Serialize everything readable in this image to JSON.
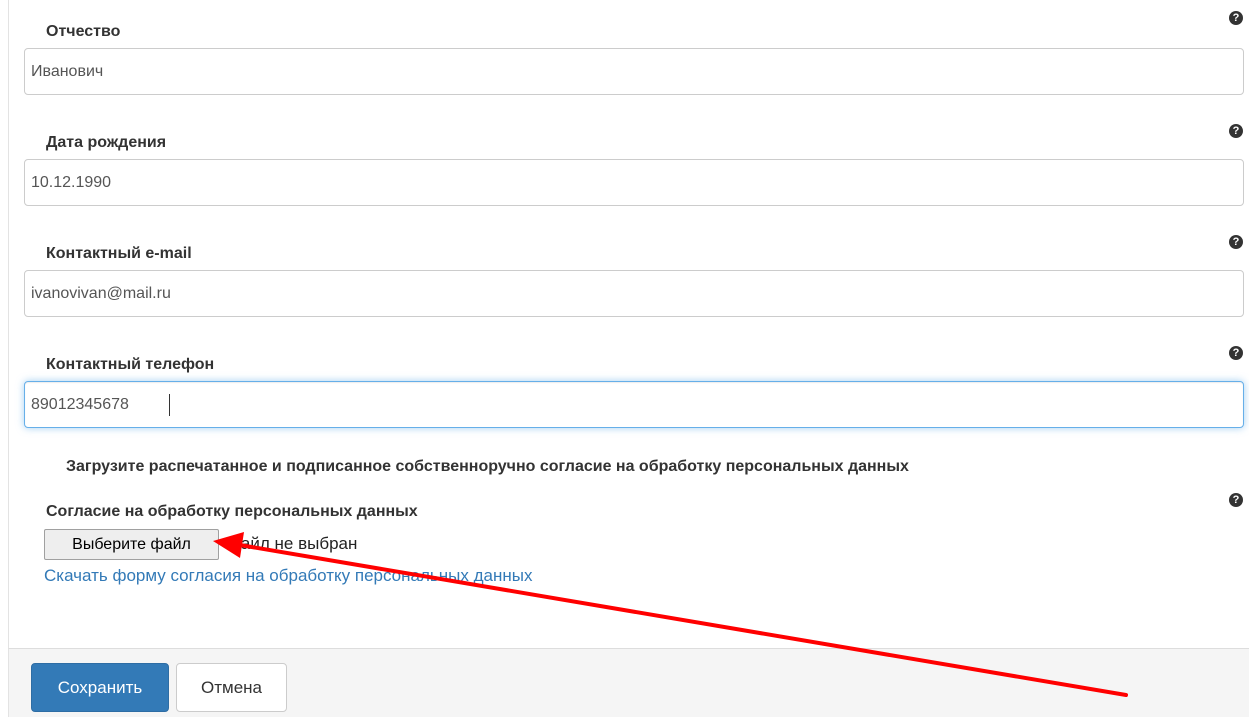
{
  "form": {
    "patronymic": {
      "label": "Отчество",
      "value": "Иванович"
    },
    "birth_date": {
      "label": "Дата рождения",
      "value": "10.12.1990"
    },
    "email": {
      "label": "Контактный e-mail",
      "value": "ivanovivan@mail.ru"
    },
    "phone": {
      "label": "Контактный телефон",
      "value": "89012345678"
    },
    "help_glyph": "?",
    "help_icon": "question-circle-icon"
  },
  "consent": {
    "notice": "Загрузите распечатанное и подписанное собственноручно согласие на обработку персональных данных",
    "label": "Согласие на обработку персональных данных",
    "file_button_label": "Выберите файл",
    "file_status": "Файл не выбран",
    "download_link": "Скачать форму согласия на обработку персональных данных"
  },
  "footer": {
    "save_label": "Сохранить",
    "cancel_label": "Отмена"
  },
  "colors": {
    "primary": "#337ab7",
    "link": "#337ab7",
    "focus_border": "#66afe9",
    "annotation_arrow": "#ff0000"
  }
}
